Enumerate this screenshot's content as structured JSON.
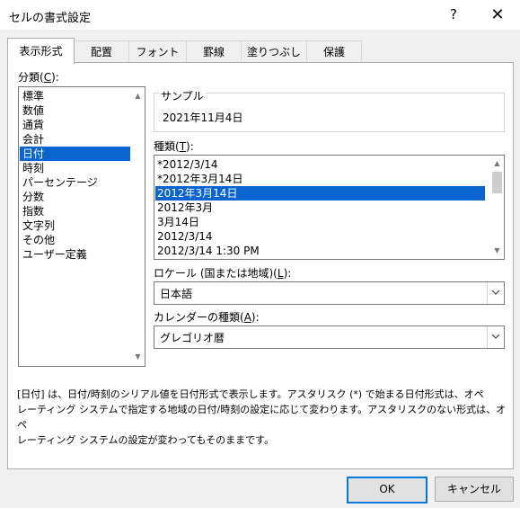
{
  "window": {
    "title": "セルの書式設定",
    "help_glyph": "?",
    "close_glyph": "✕"
  },
  "tabs": [
    {
      "label": "表示形式",
      "active": true
    },
    {
      "label": "配置"
    },
    {
      "label": "フォント"
    },
    {
      "label": "罫線"
    },
    {
      "label": "塗りつぶし"
    },
    {
      "label": "保護"
    }
  ],
  "category": {
    "label_prefix": "分類(",
    "label_key": "C",
    "label_suffix": "):",
    "items": [
      "標準",
      "数値",
      "通貨",
      "会計",
      "日付",
      "時刻",
      "パーセンテージ",
      "分数",
      "指数",
      "文字列",
      "その他",
      "ユーザー定義"
    ],
    "selected_index": 4
  },
  "sample": {
    "legend": "サンプル",
    "value": "2021年11月4日"
  },
  "type": {
    "label_prefix": "種類(",
    "label_key": "T",
    "label_suffix": "):",
    "items": [
      "*2012/3/14",
      "*2012年3月14日",
      "2012年3月14日",
      "2012年3月",
      "3月14日",
      "2012/3/14",
      "2012/3/14 1:30 PM"
    ],
    "selected_index": 2
  },
  "locale": {
    "label_prefix": "ロケール (国または地域)(",
    "label_key": "L",
    "label_suffix": "):",
    "value": "日本語"
  },
  "calendar": {
    "label_prefix": "カレンダーの種類(",
    "label_key": "A",
    "label_suffix": "):",
    "value": "グレゴリオ暦"
  },
  "description": {
    "lines": [
      "[日付] は、日付/時刻のシリアル値を日付形式で表示します。アスタリスク (*) で始まる日付形式は、オペ",
      "レーティング システムで指定する地域の日付/時刻の設定に応じて変わります。アスタリスクのない形式は、オペ",
      "レーティング システムの設定が変わってもそのままです。"
    ]
  },
  "buttons": {
    "ok": "OK",
    "cancel": "キャンセル"
  },
  "icons": {
    "scroll_up": "▲",
    "scroll_down": "▼",
    "dropdown": "chevron-down-icon"
  },
  "colors": {
    "selection": "#0a64d0",
    "default_button_border": "#0078d7"
  }
}
